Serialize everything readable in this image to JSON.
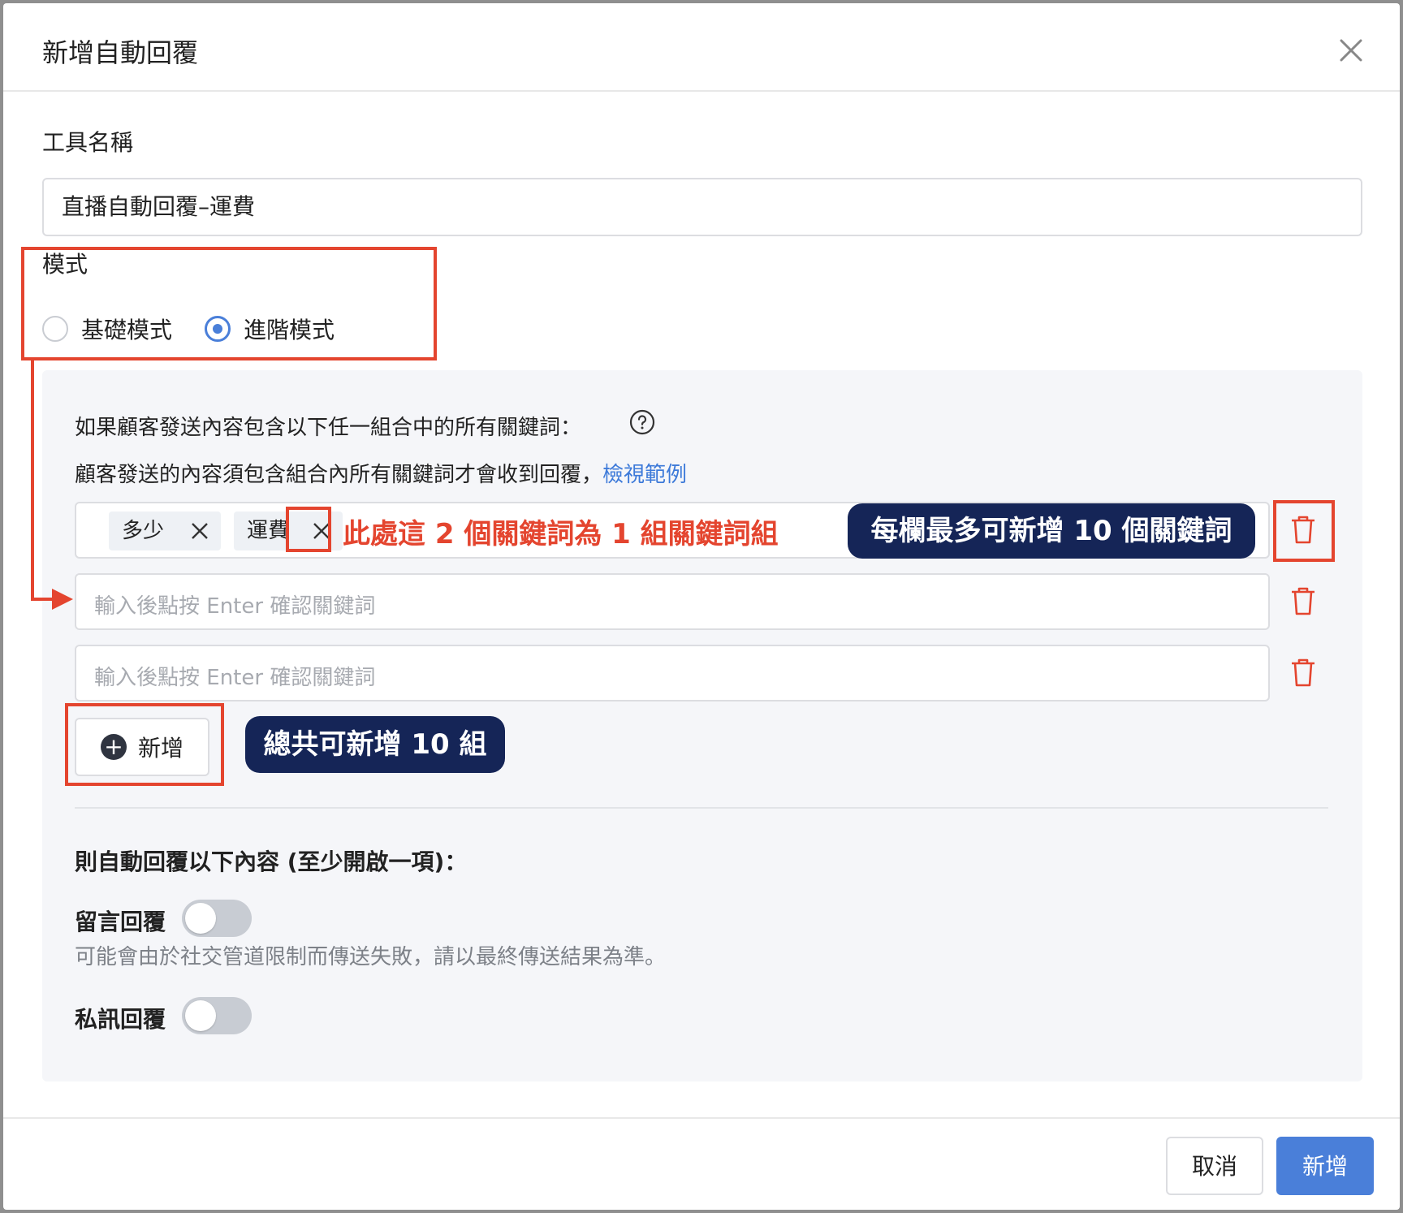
{
  "dialog": {
    "title": "新增自動回覆"
  },
  "form": {
    "tool_name_label": "工具名稱",
    "tool_name_value": "直播自動回覆–運費",
    "mode_label": "模式",
    "mode_options": [
      "基礎模式",
      "進階模式"
    ],
    "mode_selected": "進階模式"
  },
  "keywords": {
    "condition_text": "如果顧客發送內容包含以下任一組合中的所有關鍵詞：",
    "description": "顧客發送的內容須包含組合內所有關鍵詞才會收到回覆，",
    "example_link": "檢視範例",
    "group1_tags": [
      "多少",
      "運費"
    ],
    "input_placeholder": "輸入後點按 Enter 確認關鍵詞",
    "add_button": "新增"
  },
  "reply": {
    "heading": "則自動回覆以下內容 (至少開啟一項)：",
    "comment_reply_label": "留言回覆",
    "comment_reply_on": false,
    "comment_reply_hint": "可能會由於社交管道限制而傳送失敗，請以最終傳送結果為準。",
    "dm_reply_label": "私訊回覆",
    "dm_reply_on": false
  },
  "footer": {
    "cancel": "取消",
    "submit": "新增"
  },
  "annotations": {
    "group_note": "此處這 2 個關鍵詞為 1 組關鍵詞組",
    "per_row_note": "每欄最多可新增 10 個關鍵詞",
    "total_note": "總共可新增 10 組"
  },
  "colors": {
    "accent": "#4a7fd9",
    "annotation_red": "#e4452f",
    "annotation_navy": "#152557",
    "panel_bg": "#f5f6f9"
  }
}
